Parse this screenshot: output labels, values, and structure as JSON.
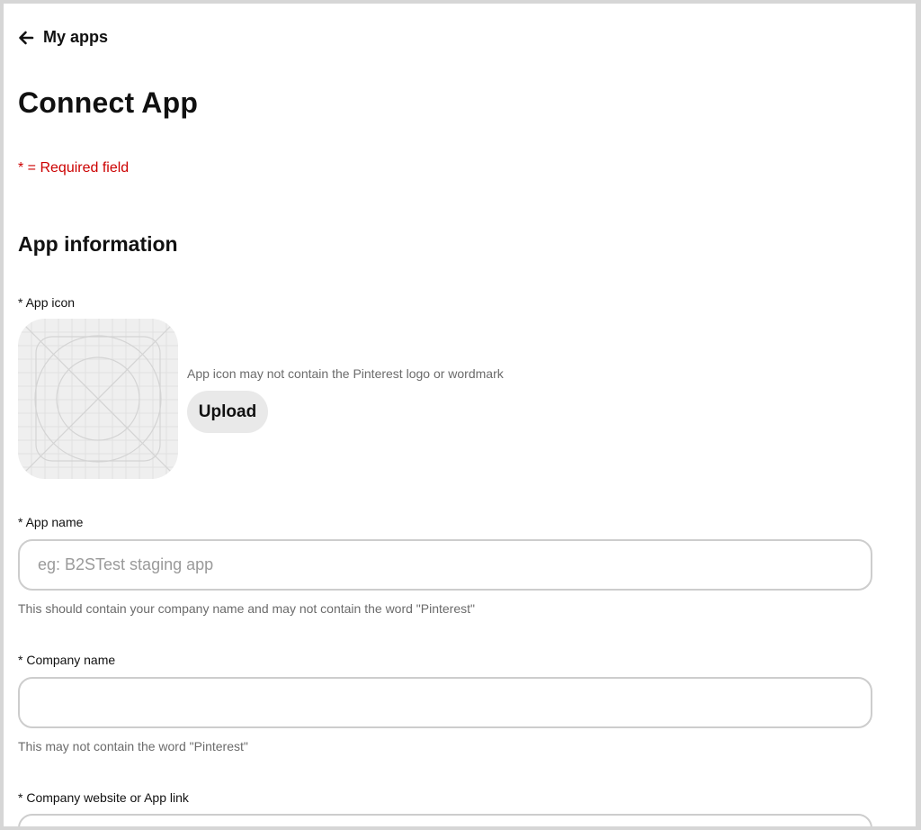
{
  "header": {
    "back_label": "My apps",
    "page_title": "Connect App",
    "required_note": "* = Required field"
  },
  "app_information": {
    "section_title": "App information",
    "app_icon": {
      "label": "* App icon",
      "hint": "App icon may not contain the Pinterest logo or wordmark",
      "upload_label": "Upload"
    },
    "app_name": {
      "label": "* App name",
      "value": "",
      "placeholder": "eg: B2STest staging app",
      "helper": "This should contain your company name and may not contain the word \"Pinterest\""
    },
    "company_name": {
      "label": "* Company name",
      "value": "",
      "placeholder": "",
      "helper": "This may not contain the word \"Pinterest\""
    },
    "company_website": {
      "label": "* Company website or App link",
      "value": "",
      "placeholder": ""
    }
  },
  "colors": {
    "required": "#cc0000",
    "upload_button_bg": "#e9e9e9",
    "input_border": "#cdcdcd",
    "helper_text": "#6b6b6b"
  },
  "icons": {
    "back": "arrow-left-icon",
    "app_icon_placeholder": "app-icon-grid-placeholder"
  }
}
